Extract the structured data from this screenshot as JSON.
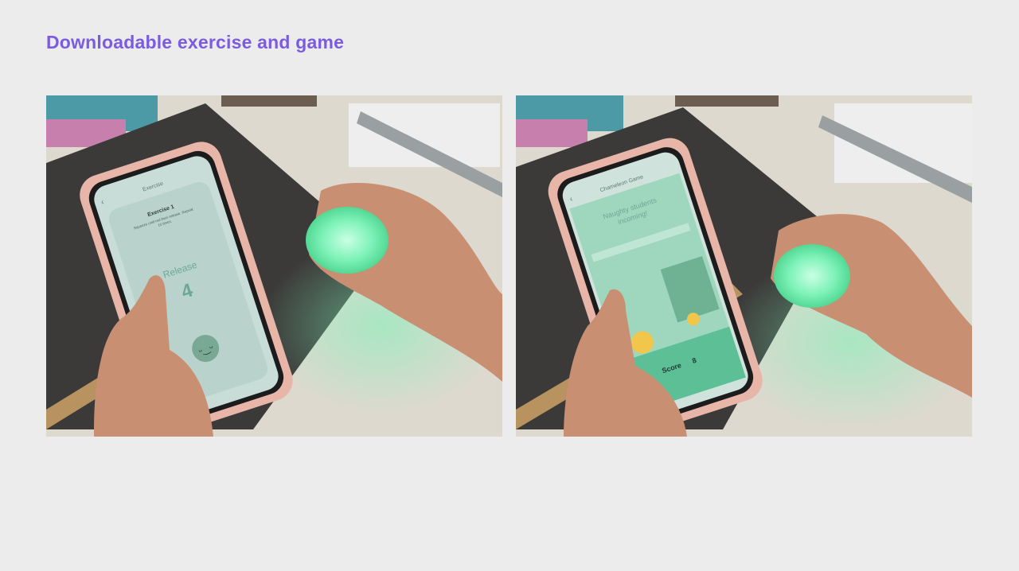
{
  "slide": {
    "title": "Downloadable exercise and game"
  },
  "left_photo": {
    "screen": {
      "header": "Exercise",
      "card_title": "Exercise 1",
      "instructions": "Squeeze until red then release. Repeat 10 times.",
      "action_label": "Release",
      "count": "4"
    }
  },
  "right_photo": {
    "screen": {
      "header": "Chameleon Game",
      "message_line1": "Naughty students",
      "message_line2": "incoming!",
      "score_label": "Score",
      "score_value": "8"
    }
  },
  "colors": {
    "title": "#7b5be0",
    "background": "#ececec",
    "glow_ball": "#7ef2b8",
    "game_green": "#8fcfb0",
    "phone_case": "#e8b6a8"
  }
}
